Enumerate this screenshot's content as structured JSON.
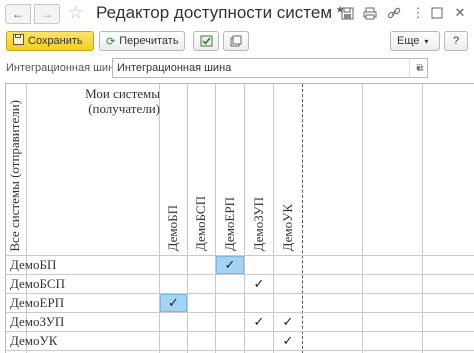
{
  "window": {
    "title": "Редактор доступности систем *",
    "back_icon": "arrow-left-icon",
    "forward_icon": "arrow-right-icon"
  },
  "toolbar": {
    "save_label": "Сохранить",
    "reread_label": "Перечитать",
    "more_label": "Еще",
    "help_label": "?"
  },
  "integration_bus": {
    "label": "Интеграционная шина:",
    "value": "Интеграционная шина"
  },
  "matrix": {
    "receivers_header": "Мои системы (получатели)",
    "senders_header": "Все системы (отправители)",
    "columns": [
      "ДемоБП",
      "ДемоБСП",
      "ДемоЕРП",
      "ДемоЗУП",
      "ДемоУК"
    ],
    "rows": [
      {
        "label": "ДемоБП",
        "cells": [
          "",
          "",
          "✓",
          "",
          ""
        ],
        "selected": 2
      },
      {
        "label": "ДемоБСП",
        "cells": [
          "",
          "",
          "",
          "✓",
          ""
        ],
        "selected": -1
      },
      {
        "label": "ДемоЕРП",
        "cells": [
          "✓",
          "",
          "",
          "",
          ""
        ],
        "selected": 0
      },
      {
        "label": "ДемоЗУП",
        "cells": [
          "",
          "",
          "",
          "✓",
          "✓"
        ],
        "selected": -1
      },
      {
        "label": "ДемоУК",
        "cells": [
          "",
          "",
          "",
          "",
          "✓"
        ],
        "selected": -1
      }
    ]
  },
  "colors": {
    "primary_button": "#f3cf1e",
    "selected_cell": "#a4d3f3"
  }
}
